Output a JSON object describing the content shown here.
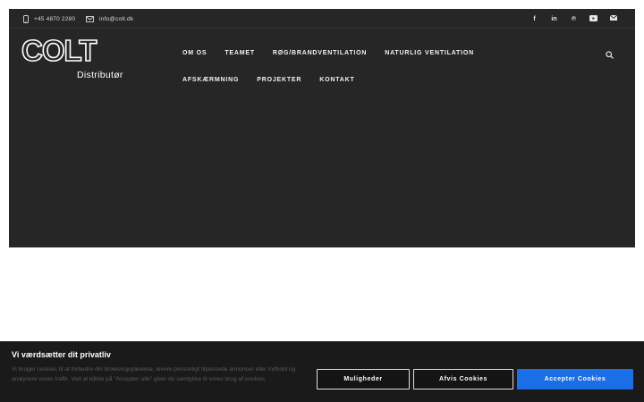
{
  "topbar": {
    "phone": "+45 4870 2280",
    "email": "info@colt.dk",
    "social_icons": [
      "facebook-icon",
      "linkedin-icon",
      "pinterest-icon",
      "youtube-icon",
      "mail-icon"
    ]
  },
  "logo": {
    "wordmark": "COLT",
    "subtitle": "Distributør"
  },
  "nav": {
    "row1": [
      "OM OS",
      "TEAMET",
      "RØG/BRANDVENTILATION",
      "NATURLIG VENTILATION"
    ],
    "row2": [
      "AFSKÆRMNING",
      "PROJEKTER",
      "KONTAKT"
    ]
  },
  "consent": {
    "title": "Vi værdsætter dit privatliv",
    "text": "Vi bruger cookies til at forbedre din browsingoplevelse, levere personligt tilpassede annoncer eller indhold og analysere vores trafik. Ved at klikke på \"Accepter alle\" giver du samtykke til vores brug af cookies",
    "options_label": "Muligheder",
    "reject_label": "Afvis Cookies",
    "accept_label": "Accepter Cookies"
  },
  "colors": {
    "header_bg": "#262626",
    "accept_button": "#1a6ee6",
    "consent_bg": "#1a1a1a"
  }
}
